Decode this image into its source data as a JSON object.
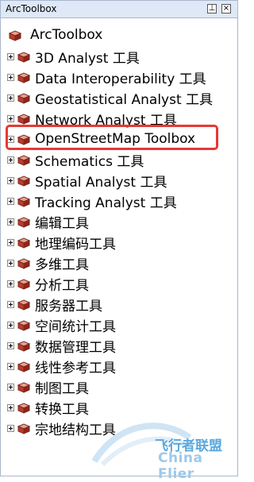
{
  "window": {
    "title": "ArcToolbox"
  },
  "tree": {
    "root_label": "ArcToolbox",
    "items": [
      {
        "label": "3D Analyst 工具"
      },
      {
        "label": "Data Interoperability 工具"
      },
      {
        "label": "Geostatistical Analyst 工具"
      },
      {
        "label": "Network Analyst 工具"
      },
      {
        "label": "OpenStreetMap Toolbox"
      },
      {
        "label": "Schematics 工具"
      },
      {
        "label": "Spatial Analyst 工具"
      },
      {
        "label": "Tracking Analyst 工具"
      },
      {
        "label": "编辑工具"
      },
      {
        "label": "地理编码工具"
      },
      {
        "label": "多维工具"
      },
      {
        "label": "分析工具"
      },
      {
        "label": "服务器工具"
      },
      {
        "label": "空间统计工具"
      },
      {
        "label": "数据管理工具"
      },
      {
        "label": "线性参考工具"
      },
      {
        "label": "制图工具"
      },
      {
        "label": "转换工具"
      },
      {
        "label": "宗地结构工具"
      }
    ],
    "highlighted_item": "OpenStreetMap Toolbox",
    "highlight_color": "#e53935"
  },
  "watermark": {
    "text_cn": "飞行者联盟",
    "text_en": "China Flier"
  },
  "icons": {
    "toolbox": "toolbox-icon",
    "expand": "expand-plus-icon",
    "pin": "pin-icon",
    "close": "close-icon"
  }
}
